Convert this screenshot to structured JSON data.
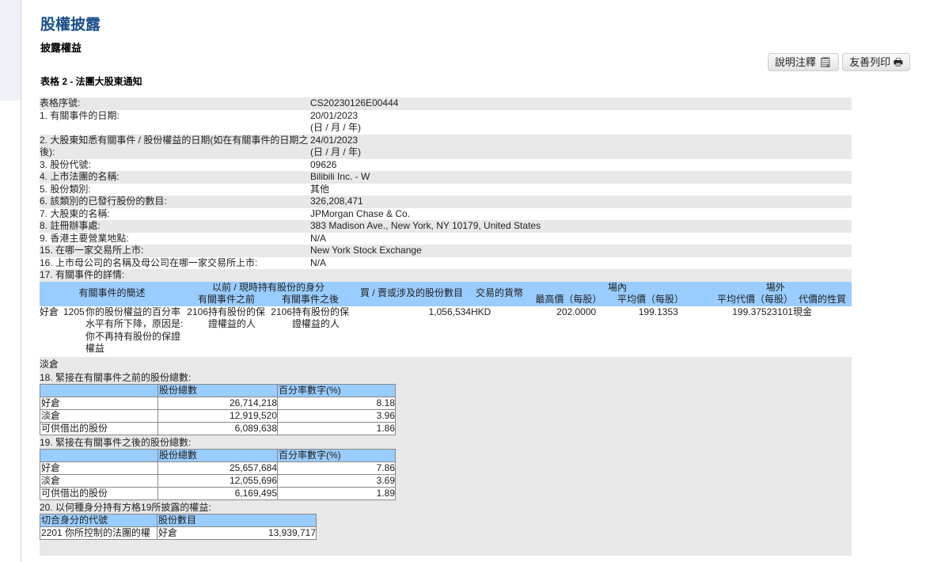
{
  "header": {
    "title": "股權披露",
    "subtitle": "披露權益",
    "form_title": "表格 2 - 法團大股東通知",
    "notes_button": "說明注釋",
    "print_button": "友善列印"
  },
  "fields": [
    {
      "label": "表格序號:",
      "value": "CS20230126E00444"
    },
    {
      "label": "1. 有關事件的日期:",
      "value": "20/01/2023",
      "note": "(日 / 月 / 年)"
    },
    {
      "label": "2. 大股東知悉有關事件 / 股份權益的日期(如在有關事件的日期之後):",
      "value": "24/01/2023",
      "note": "(日 / 月 / 年)"
    },
    {
      "label": "3. 股份代號:",
      "value": "09626"
    },
    {
      "label": "4. 上市法團的名稱:",
      "value": "Bilibili Inc. - W"
    },
    {
      "label": "5. 股份類別:",
      "value": "其他"
    },
    {
      "label": "6. 該類別的已發行股份的數目:",
      "value": "326,208,471"
    },
    {
      "label": "7. 大股東的名稱:",
      "value": "JPMorgan Chase & Co."
    },
    {
      "label": "8. 註冊辦事處:",
      "value": "383 Madison Ave., New York, NY 10179, United States"
    },
    {
      "label": "9. 香港主要營業地點:",
      "value": "N/A"
    },
    {
      "label": "15. 在哪一家交易所上市:",
      "value": "New York Stock Exchange"
    },
    {
      "label": "16. 上市母公司的名稱及母公司在哪一家交易所上市:",
      "value": "N/A"
    },
    {
      "label": "17. 有關事件的詳情:"
    }
  ],
  "event_table": {
    "headers": {
      "desc": "有關事件的簡述",
      "capacity": "以前 / 現時持有股份的身分",
      "before": "有關事件之前",
      "after": "有關事件之後",
      "shares": "買 / 賣或涉及的股份數目",
      "currency": "交易的貨幣",
      "on_exchange": "場內",
      "highest": "最高價（每股）",
      "average": "平均價（每股）",
      "off_exchange": "場外",
      "avg_consideration": "平均代價（每股）",
      "nature": "代價的性質"
    },
    "row": {
      "position": "好倉",
      "code": "1205",
      "desc": "你的股份權益的百分率水平有所下降，原因是:你不再持有股份的保證權益",
      "before_code": "2106",
      "before_desc": "持有股份的保證權益的人",
      "after_code": "2106",
      "after_desc": "持有股份的保證權益的人",
      "shares": "1,056,534",
      "currency": "HKD",
      "highest": "202.0000",
      "average": "199.1353",
      "avg_consideration": "199.37523101",
      "nature": "現金"
    },
    "short_label": "淡倉"
  },
  "s18": {
    "title": "18. 緊接在有關事件之前的股份總數:",
    "col1": "股份總數",
    "col2": "百分率數字(%)",
    "rows": [
      {
        "label": "好倉",
        "total": "26,714,218",
        "pct": "8.18"
      },
      {
        "label": "淡倉",
        "total": "12,919,520",
        "pct": "3.96"
      },
      {
        "label": "可供借出的股份",
        "total": "6,089,638",
        "pct": "1.86"
      }
    ]
  },
  "s19": {
    "title": "19. 緊接在有關事件之後的股份總數:",
    "col1": "股份總數",
    "col2": "百分率數字(%)",
    "rows": [
      {
        "label": "好倉",
        "total": "25,657,684",
        "pct": "7.86"
      },
      {
        "label": "淡倉",
        "total": "12,055,696",
        "pct": "3.69"
      },
      {
        "label": "可供借出的股份",
        "total": "6,169,495",
        "pct": "1.89"
      }
    ]
  },
  "s20": {
    "title": "20. 以何種身分持有方格19所披露的權益:",
    "col1": "切合身分的代號",
    "col2": "股份數目",
    "rows": [
      {
        "code": "2201",
        "desc": "你所控制的法團的權",
        "position": "好倉",
        "shares": "13,939,717"
      }
    ]
  }
}
